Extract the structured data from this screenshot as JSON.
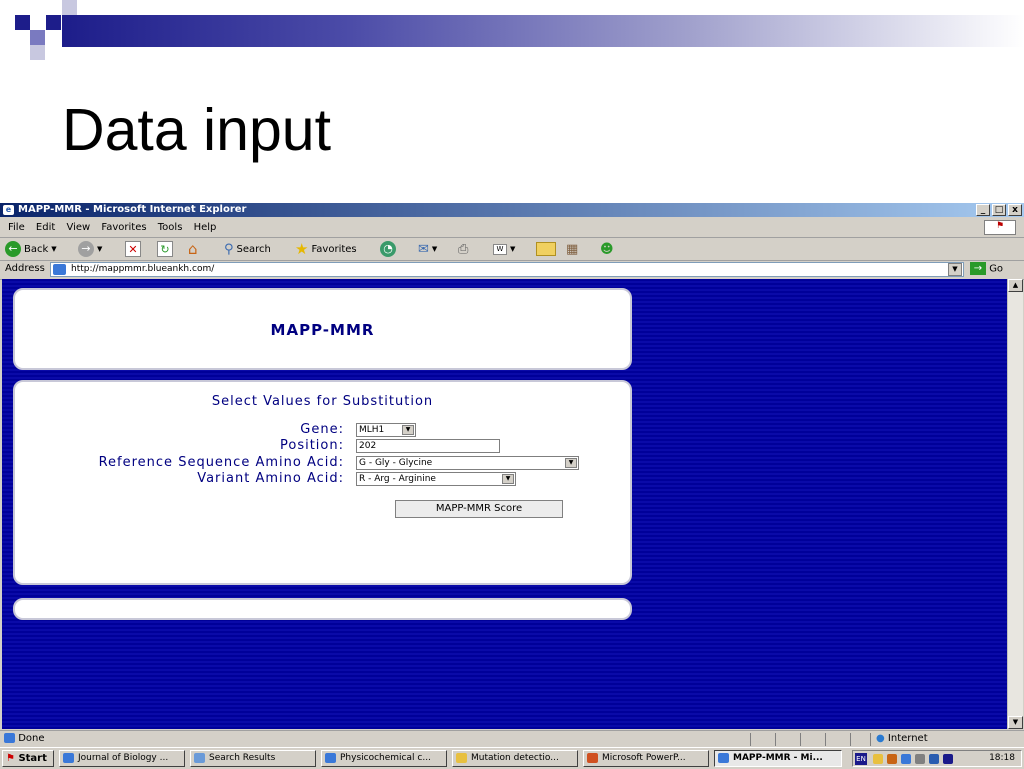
{
  "slide": {
    "title": "Data input",
    "colors": {
      "accent": "#1d1d8a",
      "accent_light": "#7a7ac0"
    }
  },
  "browser": {
    "window_title": "MAPP-MMR - Microsoft Internet Explorer",
    "window_buttons": [
      "_",
      "□",
      "x"
    ],
    "menu": [
      "File",
      "Edit",
      "View",
      "Favorites",
      "Tools",
      "Help"
    ],
    "toolbar": {
      "back": "Back",
      "search": "Search",
      "favorites": "Favorites"
    },
    "address_label": "Address",
    "address_value": "http://mappmmr.blueankh.com/",
    "go_label": "Go",
    "status_left": "Done",
    "status_zone": "Internet"
  },
  "page": {
    "app_title": "MAPP-MMR",
    "form_title": "Select Values for Substitution",
    "fields": [
      {
        "label": "Gene:",
        "value": "MLH1"
      },
      {
        "label": "Position:",
        "value": "202"
      },
      {
        "label": "Reference Sequence Amino Acid:",
        "value": "G - Gly - Glycine"
      },
      {
        "label": "Variant Amino Acid:",
        "value": "R - Arg - Arginine"
      }
    ],
    "submit_label": "MAPP-MMR Score",
    "bg_color": "#000099"
  },
  "taskbar": {
    "start_label": "Start",
    "tasks": [
      "Journal of Biology ...",
      "Search Results",
      "Physicochemical c...",
      "Mutation detectio...",
      "Microsoft PowerP...",
      "MAPP-MMR - Mi..."
    ],
    "lang": "EN",
    "clock": "18:18"
  }
}
